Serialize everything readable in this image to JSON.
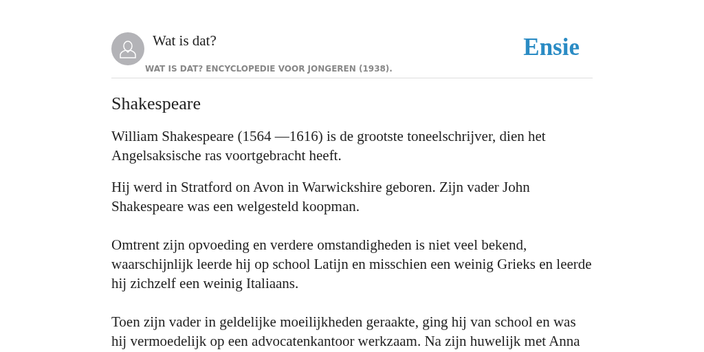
{
  "header": {
    "title": "Wat is dat?",
    "subtitle": "WAT IS DAT? ENCYCLOPEDIE VOOR JONGEREN (1938).",
    "logo": "Ensie"
  },
  "article": {
    "heading": "Shakespeare",
    "paragraphs": [
      "William Shakespeare (1564 —1616) is de grootste toneelschrijver, dien het Angelsaksische ras voortgebracht heeft.",
      "Hij werd in Stratford on Avon in Warwickshire geboren. Zijn vader John Shakespeare was een welgesteld koopman.",
      "Omtrent zijn opvoeding en verdere omstandigheden is niet veel bekend, waarschijnlijk leerde hij op school Latijn en misschien een weinig Grieks en leerde hij zichzelf een weinig Italiaans.",
      "Toen zijn vader in geldelijke moeilijkheden geraakte, ging hij van school en was hij vermoedelijk op een advocatenkantoor werkzaam. Na zijn huwelijk met Anna"
    ]
  }
}
